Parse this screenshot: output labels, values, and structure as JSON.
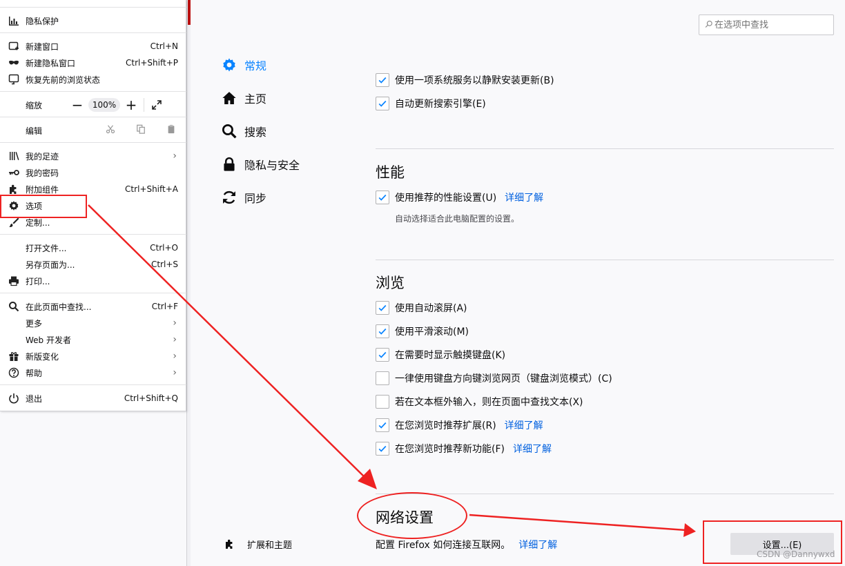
{
  "menu": {
    "items": [
      {
        "label": "隐私保护",
        "shortcut": "",
        "icon": "chart-bars-icon"
      },
      {
        "label": "新建窗口",
        "shortcut": "Ctrl+N",
        "icon": "new-window-icon"
      },
      {
        "label": "新建隐私窗口",
        "shortcut": "Ctrl+Shift+P",
        "icon": "mask-icon"
      },
      {
        "label": "恢复先前的浏览状态",
        "shortcut": "",
        "icon": "restore-icon"
      },
      {
        "label": "缩放",
        "shortcut": "",
        "icon": ""
      },
      {
        "label": "编辑",
        "shortcut": "",
        "icon": ""
      },
      {
        "label": "我的足迹",
        "shortcut": "",
        "icon": "library-icon"
      },
      {
        "label": "我的密码",
        "shortcut": "",
        "icon": "key-icon"
      },
      {
        "label": "附加组件",
        "shortcut": "Ctrl+Shift+A",
        "icon": "puzzle-icon"
      },
      {
        "label": "选项",
        "shortcut": "",
        "icon": "gear-icon"
      },
      {
        "label": "定制...",
        "shortcut": "",
        "icon": "brush-icon"
      },
      {
        "label": "打开文件...",
        "shortcut": "Ctrl+O",
        "icon": ""
      },
      {
        "label": "另存页面为...",
        "shortcut": "Ctrl+S",
        "icon": ""
      },
      {
        "label": "打印...",
        "shortcut": "",
        "icon": "printer-icon"
      },
      {
        "label": "在此页面中查找...",
        "shortcut": "Ctrl+F",
        "icon": "search-icon"
      },
      {
        "label": "更多",
        "shortcut": "",
        "icon": ""
      },
      {
        "label": "Web 开发者",
        "shortcut": "",
        "icon": ""
      },
      {
        "label": "新版变化",
        "shortcut": "",
        "icon": "gift-icon"
      },
      {
        "label": "帮助",
        "shortcut": "",
        "icon": "help-icon"
      },
      {
        "label": "退出",
        "shortcut": "Ctrl+Shift+Q",
        "icon": "power-icon"
      }
    ],
    "zoom": {
      "minus": "−",
      "value": "100%",
      "plus": "+"
    }
  },
  "search": {
    "placeholder": "在选项中查找"
  },
  "nav": {
    "general": "常规",
    "home": "主页",
    "search": "搜索",
    "privacy": "隐私与安全",
    "sync": "同步",
    "extensions": "扩展和主题"
  },
  "content": {
    "update_items": [
      {
        "label": "使用一项系统服务以静默安装更新(B)",
        "checked": true
      },
      {
        "label": "自动更新搜索引擎(E)",
        "checked": true
      }
    ],
    "performance": {
      "title": "性能",
      "checkbox": "使用推荐的性能设置(U)",
      "link": "详细了解",
      "note": "自动选择适合此电脑配置的设置。"
    },
    "browsing": {
      "title": "浏览",
      "items": [
        {
          "label": "使用自动滚屏(A)",
          "checked": true,
          "link": ""
        },
        {
          "label": "使用平滑滚动(M)",
          "checked": true,
          "link": ""
        },
        {
          "label": "在需要时显示触摸键盘(K)",
          "checked": true,
          "link": ""
        },
        {
          "label": "一律使用键盘方向键浏览网页（键盘浏览模式）(C)",
          "checked": false,
          "link": ""
        },
        {
          "label": "若在文本框外输入，则在页面中查找文本(X)",
          "checked": false,
          "link": ""
        },
        {
          "label": "在您浏览时推荐扩展(R)",
          "checked": true,
          "link": "详细了解"
        },
        {
          "label": "在您浏览时推荐新功能(F)",
          "checked": true,
          "link": "详细了解"
        }
      ]
    },
    "network": {
      "title": "网络设置",
      "description": "配置 Firefox 如何连接互联网。",
      "link": "详细了解",
      "button": "设置...(E)"
    }
  },
  "watermark": "CSDN @Dannywxd",
  "colors": {
    "accent": "#0a84ff",
    "link": "#0060df",
    "annotation": "#ee2222"
  }
}
